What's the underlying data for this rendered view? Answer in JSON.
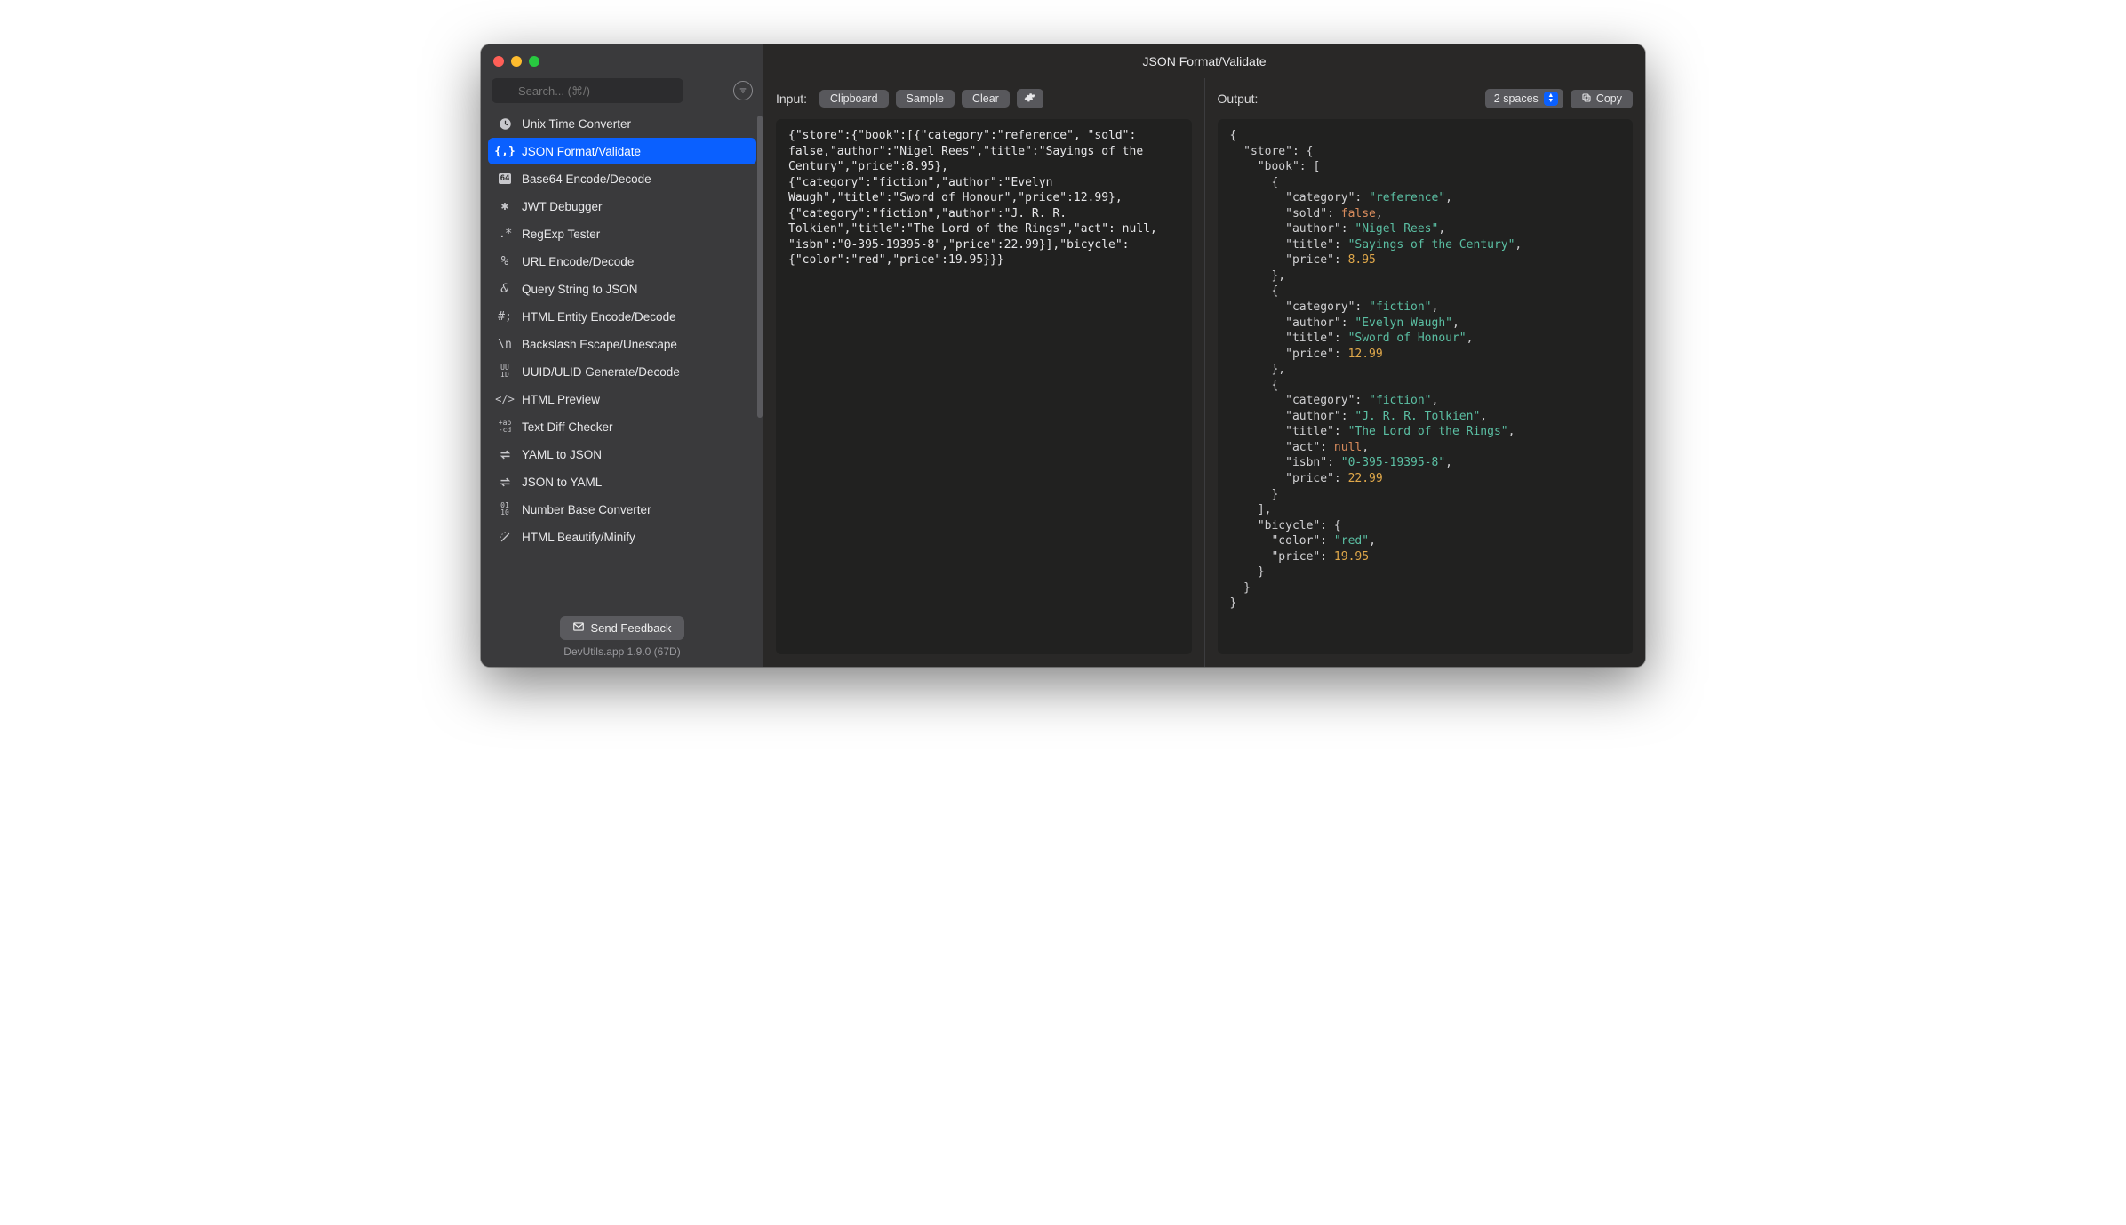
{
  "window": {
    "title": "JSON Format/Validate"
  },
  "search": {
    "placeholder": "Search... (⌘/)"
  },
  "sidebar": {
    "items": [
      {
        "label": "Unix Time Converter",
        "icon": "clock"
      },
      {
        "label": "JSON Format/Validate",
        "icon": "braces",
        "selected": true
      },
      {
        "label": "Base64 Encode/Decode",
        "icon": "b64"
      },
      {
        "label": "JWT Debugger",
        "icon": "jwt"
      },
      {
        "label": "RegExp Tester",
        "icon": "regex"
      },
      {
        "label": "URL Encode/Decode",
        "icon": "percent"
      },
      {
        "label": "Query String to JSON",
        "icon": "amp"
      },
      {
        "label": "HTML Entity Encode/Decode",
        "icon": "hash"
      },
      {
        "label": "Backslash Escape/Unescape",
        "icon": "slash"
      },
      {
        "label": "UUID/ULID Generate/Decode",
        "icon": "uuid"
      },
      {
        "label": "HTML Preview",
        "icon": "code"
      },
      {
        "label": "Text Diff Checker",
        "icon": "diff"
      },
      {
        "label": "YAML to JSON",
        "icon": "swap"
      },
      {
        "label": "JSON to YAML",
        "icon": "swap"
      },
      {
        "label": "Number Base Converter",
        "icon": "bits"
      },
      {
        "label": "HTML Beautify/Minify",
        "icon": "wand"
      }
    ],
    "feedback": "Send Feedback",
    "version": "DevUtils.app 1.9.0 (67D)"
  },
  "input_panel": {
    "label": "Input:",
    "buttons": {
      "clipboard": "Clipboard",
      "sample": "Sample",
      "clear": "Clear"
    },
    "text": "{\"store\":{\"book\":[{\"category\":\"reference\", \"sold\": false,\"author\":\"Nigel Rees\",\"title\":\"Sayings of the Century\",\"price\":8.95},{\"category\":\"fiction\",\"author\":\"Evelyn Waugh\",\"title\":\"Sword of Honour\",\"price\":12.99},{\"category\":\"fiction\",\"author\":\"J. R. R. Tolkien\",\"title\":\"The Lord of the Rings\",\"act\": null, \"isbn\":\"0-395-19395-8\",\"price\":22.99}],\"bicycle\":{\"color\":\"red\",\"price\":19.95}}}"
  },
  "output_panel": {
    "label": "Output:",
    "spaces_select": "2 spaces",
    "copy": "Copy",
    "json": {
      "store": {
        "book": [
          {
            "category": "reference",
            "sold": false,
            "author": "Nigel Rees",
            "title": "Sayings of the Century",
            "price": 8.95
          },
          {
            "category": "fiction",
            "author": "Evelyn Waugh",
            "title": "Sword of Honour",
            "price": 12.99
          },
          {
            "category": "fiction",
            "author": "J. R. R. Tolkien",
            "title": "The Lord of the Rings",
            "act": null,
            "isbn": "0-395-19395-8",
            "price": 22.99
          }
        ],
        "bicycle": {
          "color": "red",
          "price": 19.95
        }
      }
    }
  }
}
